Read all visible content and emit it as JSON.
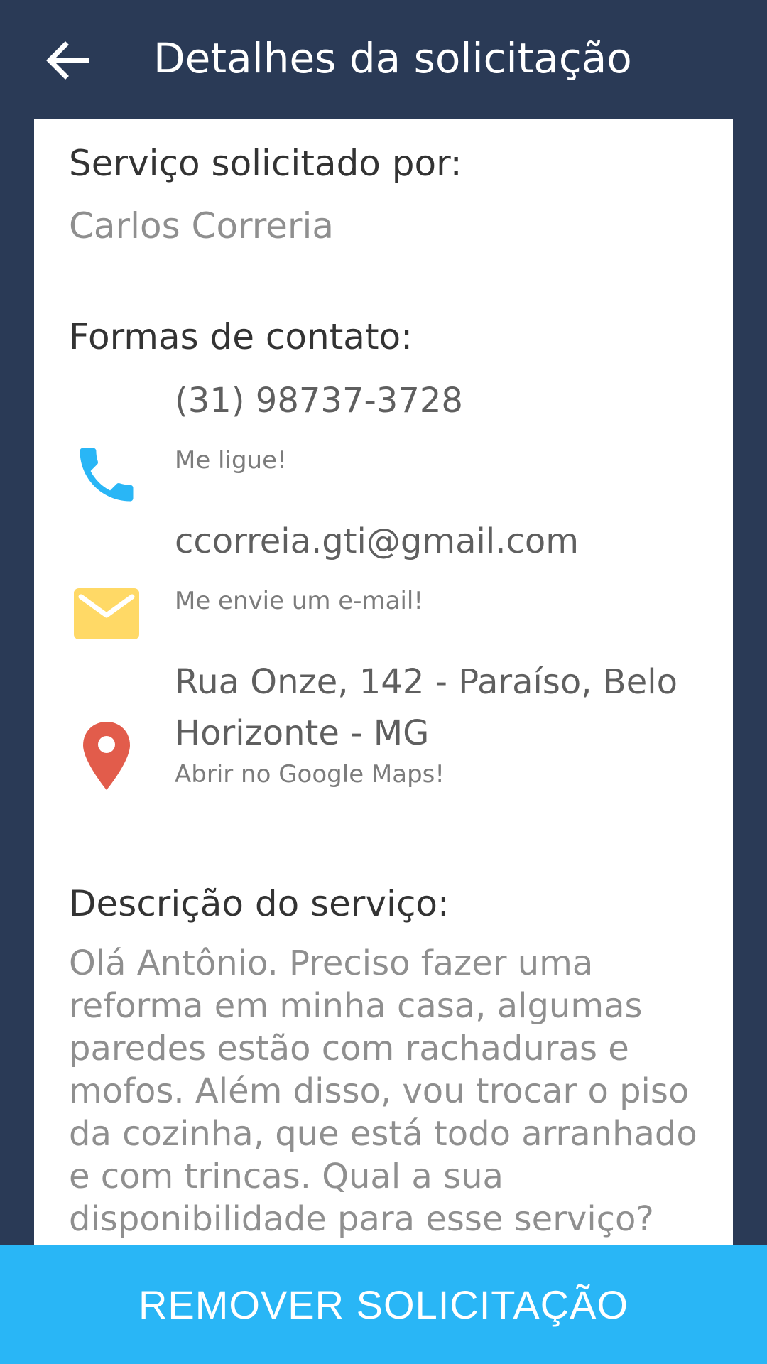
{
  "header": {
    "title": "Detalhes da solicitação",
    "back_icon": "arrow-left-icon"
  },
  "requester": {
    "heading": "Serviço solicitado por:",
    "name": "Carlos Correria"
  },
  "contact": {
    "heading": "Formas de contato:",
    "phone": {
      "icon": "phone-icon",
      "color": "#29b6f6",
      "value": "(31) 98737-3728",
      "action": "Me ligue!"
    },
    "email": {
      "icon": "mail-icon",
      "color": "#ffd966",
      "value": "ccorreia.gti@gmail.com",
      "action": "Me envie um e-mail!"
    },
    "address": {
      "icon": "map-pin-icon",
      "color": "#e25c4b",
      "line1": "Rua Onze, 142 - Paraíso, Belo",
      "line2": "Horizonte - MG",
      "action": "Abrir no Google Maps!"
    }
  },
  "description": {
    "heading": "Descrição do serviço:",
    "text": "Olá Antônio. Preciso fazer uma reforma em minha casa, algumas paredes estão com rachaduras e mofos. Além disso, vou trocar o piso da cozinha, que está todo arranhado e com trincas. Qual a sua disponibilidade para esse serviço?"
  },
  "footer": {
    "button_label": "REMOVER SOLICITAÇÃO",
    "button_color": "#29b6f6"
  },
  "colors": {
    "primary_dark": "#2a3a56",
    "accent": "#29b6f6"
  }
}
